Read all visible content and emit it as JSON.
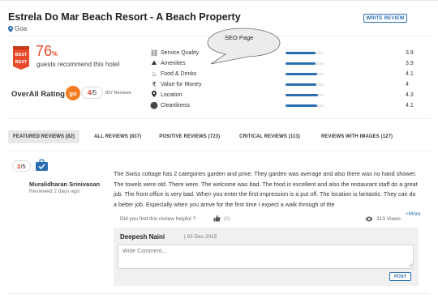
{
  "hotel": {
    "title": "Estrela Do Mar Beach Resort - A Beach Property",
    "location": "Goa",
    "write_review_label": "WRITE REVIEW"
  },
  "summary": {
    "badge_text": "BEST",
    "recommend_percent": "76",
    "percent_sign": "%",
    "recommend_text": "guests recommend this hotel",
    "overall_label": "OverAll Rating",
    "go_badge": "go",
    "overall_score": "4",
    "overall_scale": "/5",
    "reviews_count": "837 Reviews"
  },
  "annotation": {
    "bubble_text": "SEO Page"
  },
  "ratings": [
    {
      "label": "Service Quality",
      "value": "3.9",
      "fraction": 0.78,
      "icon": "bellhop-icon"
    },
    {
      "label": "Amenities",
      "value": "3.9",
      "fraction": 0.78,
      "icon": "amenities-icon"
    },
    {
      "label": "Food & Drinks",
      "value": "4.1",
      "fraction": 0.82,
      "icon": "food-icon"
    },
    {
      "label": "Value for Money",
      "value": "4",
      "fraction": 0.8,
      "icon": "rupee-icon"
    },
    {
      "label": "Location",
      "value": "4.3",
      "fraction": 0.86,
      "icon": "location-pin-icon"
    },
    {
      "label": "Cleanliness",
      "value": "4.1",
      "fraction": 0.82,
      "icon": "cleanliness-icon"
    }
  ],
  "tabs": [
    {
      "label": "FEATURED REVIEWS (82)",
      "active": true
    },
    {
      "label": "ALL REVIEWS (837)",
      "active": false
    },
    {
      "label": "POSITIVE REVIEWS (723)",
      "active": false
    },
    {
      "label": "CRITICAL REVIEWS (113)",
      "active": false
    },
    {
      "label": "REVIEWS WITH IMAGES (127)",
      "active": false
    }
  ],
  "review": {
    "score": "2",
    "scale": "/5",
    "reviewer": "Muralidharan Srinivasan",
    "date": "Reviewed 2 days ago",
    "text": "The Swiss cottage has 2 categories garden and prive. They garden was average and also there was no hand shower. The towels were old. There were. The welcome was bad. The food is excellent and also the restaurant staff do a great job. The front office is very bad. When you enter the first impression is a put off. The location is fantastic. They can do a better job. Especially when you arrive for the first time I expect a walk through of the",
    "more_label": "+More",
    "helpful_question": "Did you find this review helpful ?",
    "helpful_count": "(0)",
    "views": "313 Views"
  },
  "comment": {
    "commenter": "Deepesh Naini",
    "date": "| 03 Dec 2015",
    "placeholder": "Write Comment...",
    "post_label": "POST"
  },
  "colors": {
    "accent_blue": "#2a6db2",
    "accent_orange": "#f47c20",
    "score_red": "#e84a2a"
  }
}
